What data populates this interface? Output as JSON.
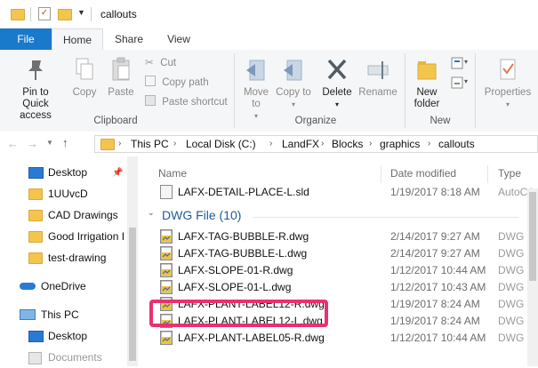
{
  "window": {
    "title": "callouts"
  },
  "tabs": {
    "file": "File",
    "home": "Home",
    "share": "Share",
    "view": "View"
  },
  "ribbon": {
    "clipboard": {
      "pin": "Pin to Quick access",
      "copy": "Copy",
      "paste": "Paste",
      "cut": "Cut",
      "copy_path": "Copy path",
      "paste_shortcut": "Paste shortcut",
      "label": "Clipboard"
    },
    "organize": {
      "move_to": "Move to",
      "copy_to": "Copy to",
      "delete": "Delete",
      "rename": "Rename",
      "label": "Organize"
    },
    "new": {
      "new_folder": "New folder",
      "label": "New"
    },
    "open": {
      "properties": "Properties"
    }
  },
  "address": {
    "crumbs": [
      "This PC",
      "Local Disk (C:)",
      "LandFX",
      "Blocks",
      "graphics",
      "callouts"
    ]
  },
  "nav": {
    "items": [
      {
        "label": "Desktop"
      },
      {
        "label": "1UUvcD"
      },
      {
        "label": "CAD Drawings"
      },
      {
        "label": "Good Irrigation I"
      },
      {
        "label": "test-drawing"
      },
      {
        "label": "OneDrive"
      },
      {
        "label": "This PC"
      },
      {
        "label": "Desktop"
      },
      {
        "label": "Documents"
      }
    ]
  },
  "columns": {
    "name": "Name",
    "date": "Date modified",
    "type": "Type"
  },
  "files_top": [
    {
      "name": "LAFX-DETAIL-PLACE-L.sld",
      "date": "1/19/2017 8:18 AM",
      "type": "AutoCA"
    }
  ],
  "group": {
    "label": "DWG File (10)"
  },
  "files": [
    {
      "name": "LAFX-TAG-BUBBLE-R.dwg",
      "date": "2/14/2017 9:27 AM",
      "type": "DWG Fi"
    },
    {
      "name": "LAFX-TAG-BUBBLE-L.dwg",
      "date": "2/14/2017 9:27 AM",
      "type": "DWG Fi"
    },
    {
      "name": "LAFX-SLOPE-01-R.dwg",
      "date": "1/12/2017 10:44 AM",
      "type": "DWG Fi"
    },
    {
      "name": "LAFX-SLOPE-01-L.dwg",
      "date": "1/12/2017 10:43 AM",
      "type": "DWG Fi"
    },
    {
      "name": "LAFX-PLANT-LABEL12-R.dwg",
      "date": "1/19/2017 8:24 AM",
      "type": "DWG Fi"
    },
    {
      "name": "LAFX-PLANT-LABEL12-L.dwg",
      "date": "1/19/2017 8:24 AM",
      "type": "DWG Fi"
    },
    {
      "name": "LAFX-PLANT-LABEL05-R.dwg",
      "date": "1/12/2017 10:44 AM",
      "type": "DWG Fi"
    }
  ],
  "colors": {
    "accent": "#1979ca",
    "highlight": "#e8316f",
    "folder": "#f3c54d"
  }
}
